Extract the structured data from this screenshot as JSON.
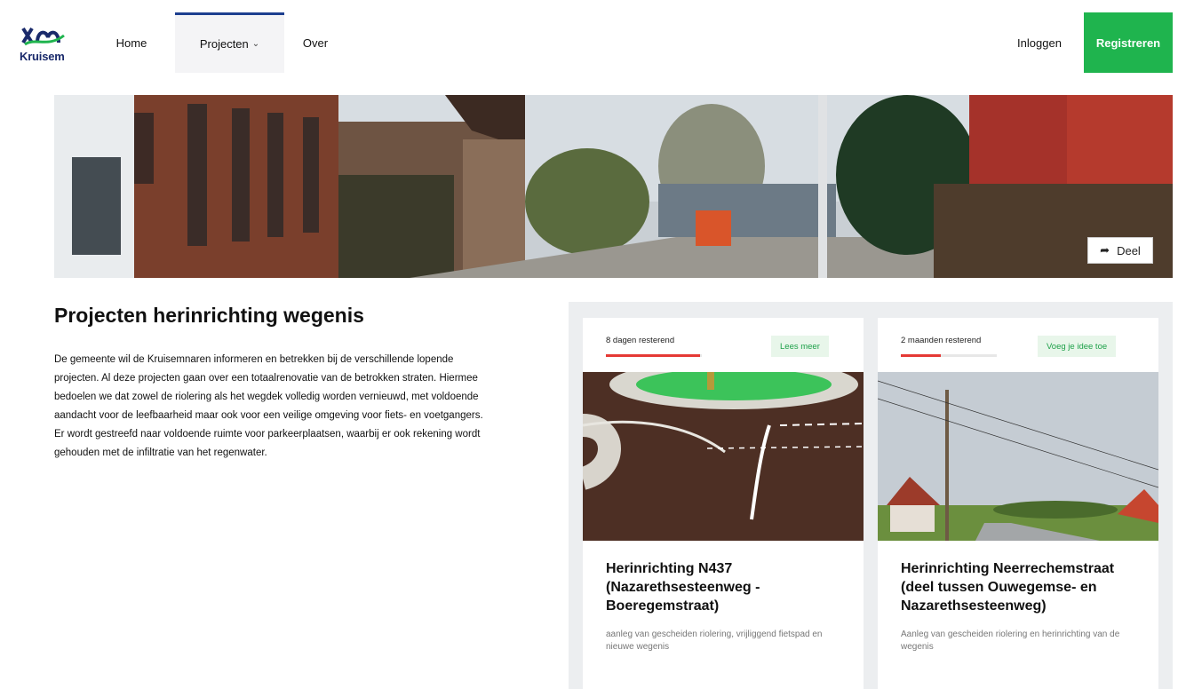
{
  "header": {
    "logo_text": "Kruisem",
    "nav": {
      "home": "Home",
      "projecten": "Projecten",
      "over": "Over"
    },
    "login": "Inloggen",
    "register": "Registreren",
    "colors": {
      "accent": "#1fb44e",
      "active_nav_border": "#1d3f8f"
    }
  },
  "hero": {
    "share_label": "Deel",
    "share_icon": "share-arrow-icon"
  },
  "intro": {
    "title": "Projecten herinrichting wegenis",
    "text": "De gemeente wil de Kruisemnaren informeren en betrekken bij de verschillende lopende projecten. Al deze projecten gaan over een totaalrenovatie van de betrokken straten. Hiermee bedoelen we dat zowel de riolering als het wegdek volledig worden vernieuwd, met voldoende aandacht voor de leefbaarheid maar ook voor een veilige omgeving voor fiets- en voetgangers. Er wordt gestreefd naar voldoende ruimte voor parkeerplaatsen, waarbij er ook rekening wordt gehouden met de infiltratie van het regenwater."
  },
  "cards": [
    {
      "remaining": "8 dagen resterend",
      "progress": 0.98,
      "action": "Lees meer",
      "title": "Herinrichting N437 (Nazarethsesteenweg - Boeregemstraat)",
      "description": "aanleg van gescheiden riolering, vrijliggend fietspad en nieuwe wegenis"
    },
    {
      "remaining": "2 maanden resterend",
      "progress": 0.42,
      "action": "Voeg je idee toe",
      "title": "Herinrichting Neerrechemstraat (deel tussen Ouwegemse- en Nazarethsesteenweg)",
      "description": "Aanleg van gescheiden riolering en herinrichting van de wegenis"
    }
  ]
}
